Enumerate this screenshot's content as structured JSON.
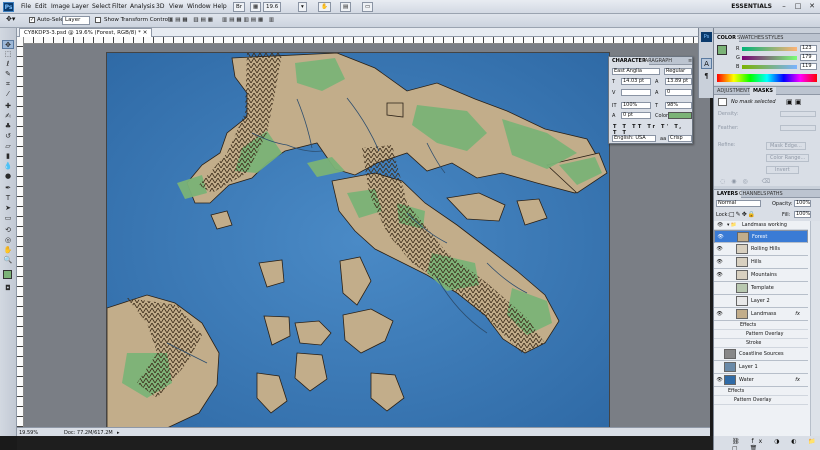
{
  "menubar": {
    "logo": "Ps",
    "items": [
      "File",
      "Edit",
      "Image",
      "Layer",
      "Select",
      "Filter",
      "Analysis",
      "3D",
      "View",
      "Window",
      "Help"
    ],
    "zoom": "19.6",
    "workspace": "ESSENTIALS"
  },
  "options": {
    "auto_select_label": "Auto-Select:",
    "auto_select_value": "Layer",
    "show_transform_label": "Show Transform Controls"
  },
  "document": {
    "tab_title": "CY8KDP3-3.psd @ 19.6% (Forest, RGB/8) *",
    "status_zoom": "19.59%",
    "status_doc": "Doc: 77.2M/617.2M"
  },
  "character": {
    "tabs": [
      "CHARACTER",
      "PARAGRAPH"
    ],
    "font_family": "East Anglia",
    "font_style": "Regular",
    "font_size": "14.03 pt",
    "leading": "13.89 pt",
    "tracking": "0",
    "vertical_scale": "100%",
    "horizontal_scale": "98%",
    "baseline": "0 pt",
    "color_label": "Color:",
    "style_buttons": [
      "T",
      "T",
      "TT",
      "Tr",
      "T'",
      "T,",
      "T",
      "T"
    ],
    "language": "English: USA",
    "antialias": "Crisp"
  },
  "color_panel": {
    "tabs": [
      "COLOR",
      "SWATCHES",
      "STYLES"
    ],
    "r_label": "R",
    "r_value": "123",
    "g_label": "G",
    "g_value": "179",
    "b_label": "B",
    "b_value": "119",
    "foreground": "#7bb377",
    "background": "#f2e85a"
  },
  "adjustments": {
    "tabs": [
      "ADJUSTMENTS",
      "MASKS"
    ],
    "mask_text": "No mask selected",
    "density": "Density:",
    "feather": "Feather:",
    "refine": "Refine:",
    "mask_edge": "Mask Edge...",
    "color_range": "Color Range...",
    "invert": "Invert"
  },
  "layers": {
    "tabs": [
      "LAYERS",
      "CHANNELS",
      "PATHS"
    ],
    "blend_mode": "Normal",
    "opacity_label": "Opacity:",
    "opacity": "100%",
    "lock_label": "Lock:",
    "fill_label": "Fill:",
    "fill": "100%",
    "group_name": "Landmass working",
    "rows": [
      {
        "name": "Forest",
        "visible": true,
        "selected": true,
        "fx": ""
      },
      {
        "name": "Rolling Hills",
        "visible": true,
        "selected": false,
        "fx": ""
      },
      {
        "name": "Hills",
        "visible": true,
        "selected": false,
        "fx": ""
      },
      {
        "name": "Mountains",
        "visible": true,
        "selected": false,
        "fx": ""
      },
      {
        "name": "Template",
        "visible": false,
        "selected": false,
        "fx": ""
      },
      {
        "name": "Layer 2",
        "visible": false,
        "selected": false,
        "fx": ""
      },
      {
        "name": "Landmass",
        "visible": true,
        "selected": false,
        "fx": "fx"
      }
    ],
    "landmass_effects": [
      "Effects",
      "Pattern Overlay",
      "Stroke"
    ],
    "rows2": [
      {
        "name": "Coastline Sources",
        "visible": false,
        "fx": ""
      },
      {
        "name": "Layer 1",
        "visible": false,
        "fx": ""
      },
      {
        "name": "Water",
        "visible": true,
        "fx": "fx"
      }
    ],
    "water_effects": [
      "Effects",
      "Pattern Overlay"
    ]
  }
}
